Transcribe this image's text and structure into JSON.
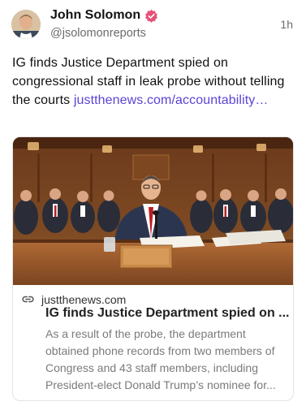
{
  "author": {
    "name": "John Solomon",
    "handle": "@jsolomonreports",
    "verified_icon": "verified-badge-icon",
    "verified_color": "#e5527a"
  },
  "post": {
    "time": "1h",
    "text": "IG finds Justice Department spied on congressional staff in leak probe without telling the courts ",
    "link_text": "justthenews.com/accountability…",
    "link_color": "#5b44d6"
  },
  "link_card": {
    "domain": "justthenews.com",
    "title": "IG finds Justice Department spied on ...",
    "description": "As a result of the probe, the department obtained phone records from two members of Congress and 43 staff members, including President-elect Donald Trump’s nominee for..."
  }
}
